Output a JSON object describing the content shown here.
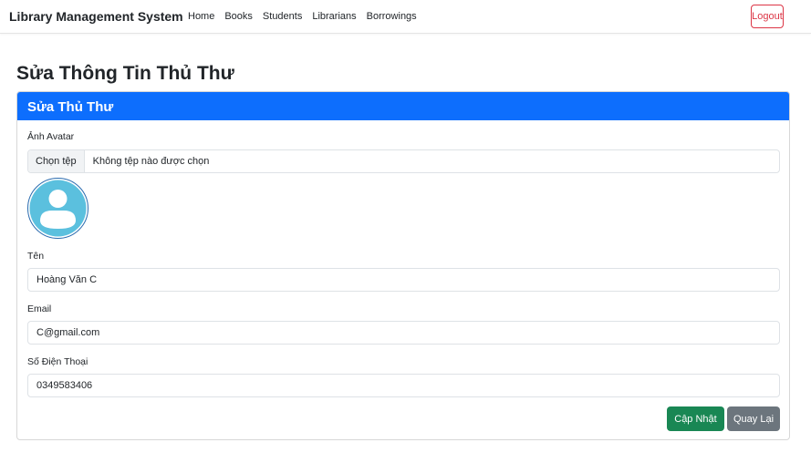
{
  "navbar": {
    "brand": "Library Management System",
    "links": [
      "Home",
      "Books",
      "Students",
      "Librarians",
      "Borrowings"
    ],
    "logout_label": "Logout"
  },
  "page": {
    "title": "Sửa Thông Tin Thủ Thư"
  },
  "card": {
    "header": "Sửa Thủ Thư",
    "avatar": {
      "label": "Ảnh Avatar",
      "choose_file_label": "Chọn tệp",
      "no_file_text": "Không tệp nào được chọn",
      "icon": "user-avatar-icon",
      "color": "#5bc0de"
    },
    "name": {
      "label": "Tên",
      "value": "Hoàng Văn C"
    },
    "email": {
      "label": "Email",
      "value": "C@gmail.com"
    },
    "phone": {
      "label": "Số Điện Thoại",
      "value": "0349583406"
    },
    "buttons": {
      "update": "Cập Nhật",
      "back": "Quay Lại"
    }
  },
  "colors": {
    "primary": "#0d6efd",
    "success": "#198754",
    "secondary": "#6c757d",
    "danger": "#dc3545"
  }
}
